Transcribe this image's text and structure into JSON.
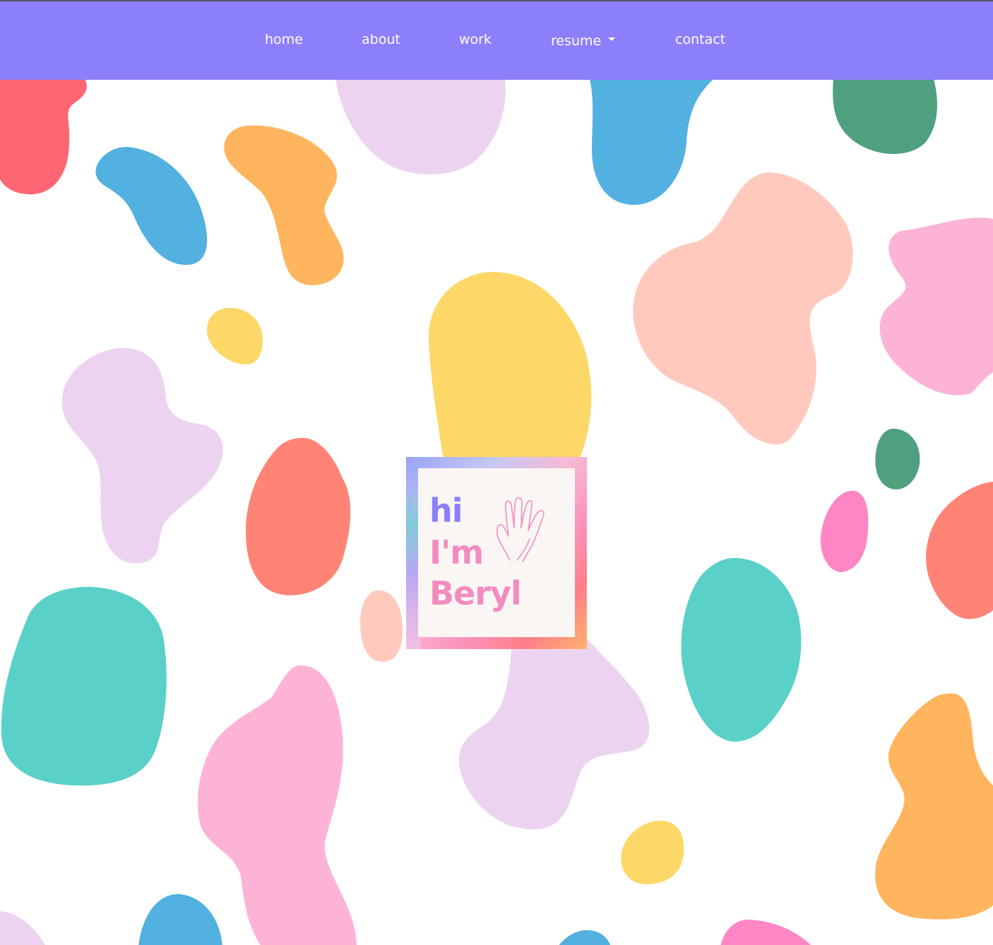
{
  "nav": {
    "items": [
      {
        "label": "home"
      },
      {
        "label": "about"
      },
      {
        "label": "work"
      },
      {
        "label": "resume",
        "has_dropdown": true
      },
      {
        "label": "contact"
      }
    ],
    "background_color": "#8b7ffc"
  },
  "hero": {
    "line1": "hi",
    "line2": "I'm",
    "line3": "Beryl",
    "icon": "waving-hand-icon",
    "colors": {
      "line1": "#8b7ffc",
      "line2": "#f28cc0",
      "line3": "#f28cc0"
    }
  },
  "background": {
    "pattern": "colorful-blobs",
    "palette": [
      "#ff6673",
      "#52b1e0",
      "#ffb45e",
      "#ecd4f0",
      "#4fa07e",
      "#ffcabd",
      "#fdb3d6",
      "#fdd767",
      "#ff8476",
      "#5ad1c8",
      "#ff86c4"
    ]
  }
}
